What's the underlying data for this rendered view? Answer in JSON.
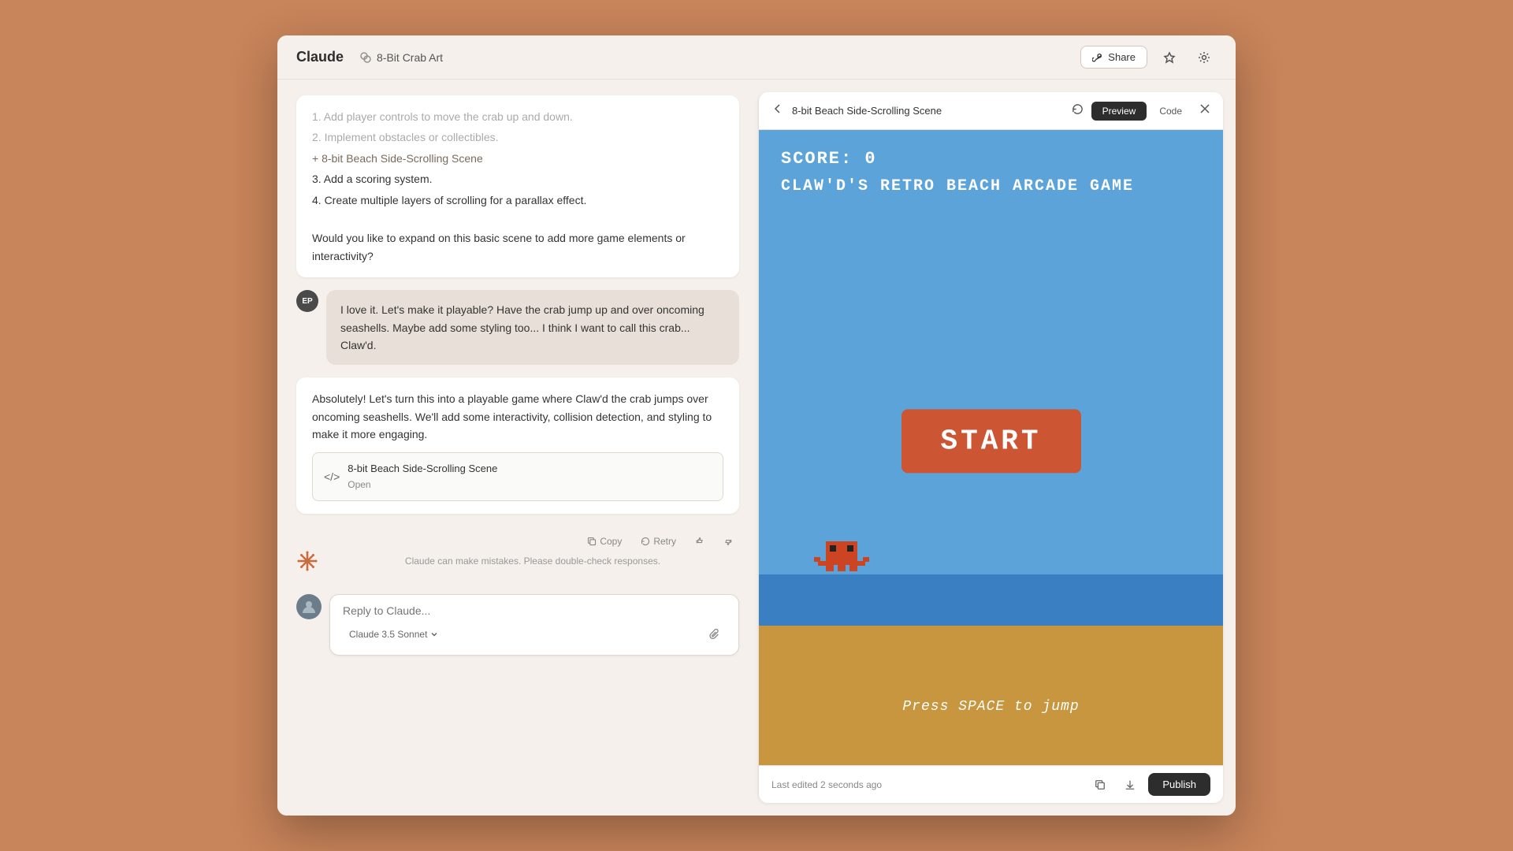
{
  "header": {
    "logo": "Claude",
    "project_name": "8-Bit Crab Art",
    "share_label": "Share"
  },
  "chat": {
    "messages": [
      {
        "type": "assistant_partial",
        "lines": [
          "1. Add player controls to move the crab up and down.",
          "2. Implement obstacles or collectibles.",
          "+ 8-bit Beach Side-Scrolling Scene",
          "3. Add a scoring system.",
          "4. Create multiple layers of scrolling for a parallax effect."
        ],
        "followup": "Would you like to expand on this basic scene to add more game elements or interactivity?"
      },
      {
        "type": "user",
        "initials": "EP",
        "text": "I love it. Let's make it playable? Have the crab jump up and over oncoming seashells. Maybe add some styling too... I think I want to call this crab... Claw'd."
      },
      {
        "type": "assistant",
        "intro": "Absolutely! Let's turn this into a playable game where Claw'd the crab jumps over oncoming seashells. We'll add some interactivity, collision detection, and styling to make it more engaging.",
        "artifact_title": "8-bit Beach Side-Scrolling Scene",
        "artifact_sub": "Open"
      }
    ],
    "actions": {
      "copy": "Copy",
      "retry": "Retry"
    },
    "disclaimer": "Claude can make mistakes. Please double-check responses.",
    "input_placeholder": "Reply to Claude...",
    "model_label": "Claude 3.5 Sonnet"
  },
  "preview": {
    "title": "8-bit Beach Side-Scrolling Scene",
    "tab_preview": "Preview",
    "tab_code": "Code",
    "last_edited": "Last edited 2 seconds ago",
    "publish_label": "Publish",
    "game": {
      "score_label": "SCORE: 0",
      "title_label": "CLAW'D'S RETRO BEACH ARCADE GAME",
      "start_label": "START",
      "press_space": "Press SPACE to jump"
    }
  }
}
